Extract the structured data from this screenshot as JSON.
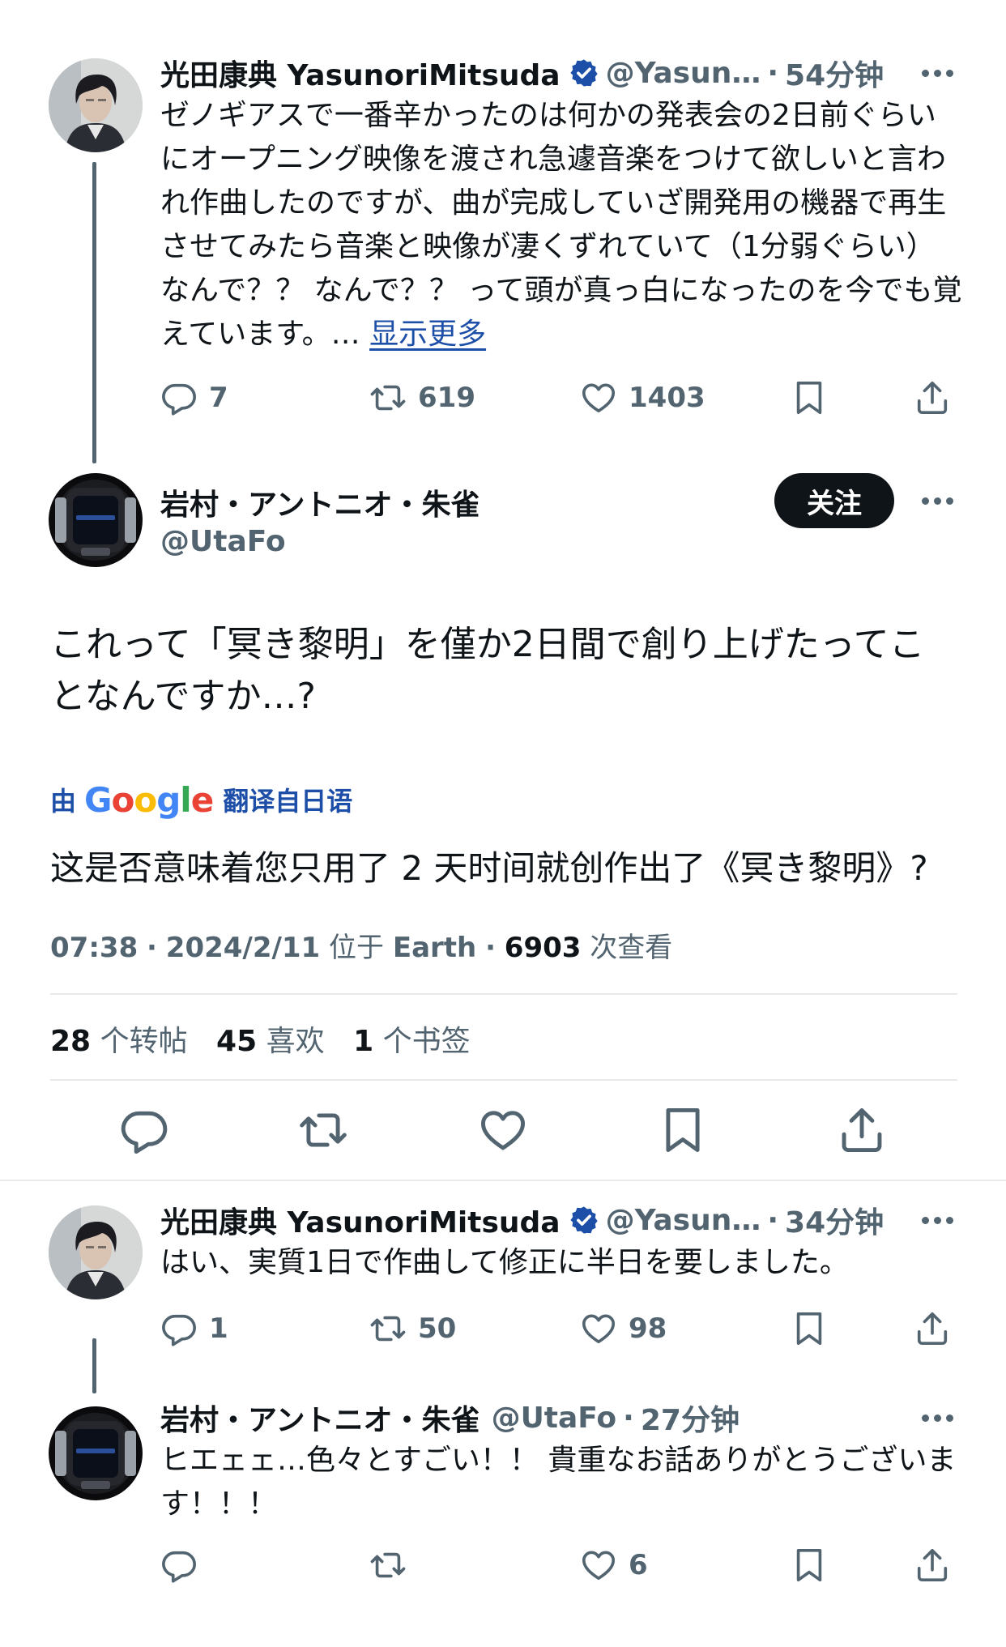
{
  "tweets": {
    "parent": {
      "name": "光田康典 YasunoriMitsuda",
      "handle": "@Yasun…",
      "separator": "·",
      "time": "54分钟",
      "text": "ゼノギアスで一番辛かったのは何かの発表会の2日前ぐらいにオープニング映像を渡され急遽音楽をつけて欲しいと言われ作曲したのですが、曲が完成していざ開発用の機器で再生させてみたら音楽と映像が凄くずれていて（1分弱ぐらい）なんで？？ なんで？？ って頭が真っ白になったのを今でも覚えています。…",
      "show_more": "显示更多",
      "replies": "7",
      "retweets": "619",
      "likes": "1403"
    },
    "main": {
      "name": "岩村・アントニオ・朱雀",
      "handle": "@UtaFo",
      "follow_label": "关注",
      "text": "これって「冥き黎明」を僅か2日間で創り上げたってことなんですか…?",
      "translate_prefix": "由",
      "translate_brand": "Google",
      "translate_suffix": "翻译自日语",
      "translation": "这是否意味着您只用了 2 天时间就创作出了《冥き黎明》?",
      "time": "07:38",
      "date": "2024/2/11",
      "location_prefix": "位于",
      "location": "Earth",
      "views": "6903",
      "views_label": "次查看",
      "separator": "·",
      "retweets_count": "28",
      "retweets_label": "个转帖",
      "likes_count": "45",
      "likes_label": "喜欢",
      "bookmarks_count": "1",
      "bookmarks_label": "个书签"
    },
    "reply1": {
      "name": "光田康典 YasunoriMitsuda",
      "handle": "@Yasun…",
      "separator": "·",
      "time": "34分钟",
      "text": "はい、実質1日で作曲して修正に半日を要しました。",
      "replies": "1",
      "retweets": "50",
      "likes": "98"
    },
    "reply2": {
      "name": "岩村・アントニオ・朱雀",
      "handle": "@UtaFo",
      "separator": "·",
      "time": "27分钟",
      "text": "ヒエェェ…色々とすごい！！ 貴重なお話ありがとうございます！！！",
      "likes": "6"
    }
  },
  "colors": {
    "text": "#0f1419",
    "secondary": "#536471",
    "link": "#1d4fa8",
    "verified": "#1d4fa8",
    "divider": "#e7e9ea",
    "follow_bg": "#0f1419"
  },
  "icons": [
    "reply-icon",
    "retweet-icon",
    "like-icon",
    "bookmark-icon",
    "share-icon",
    "verified-badge-icon",
    "more-options-icon"
  ]
}
